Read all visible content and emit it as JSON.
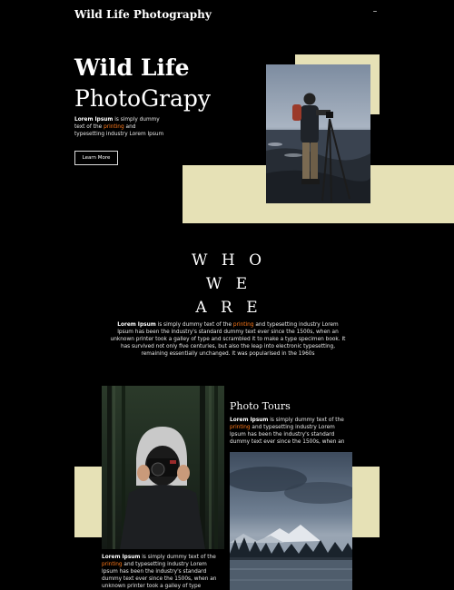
{
  "header": {
    "brand": "Wild Life Photography",
    "menu_icon": "menu-icon"
  },
  "hero": {
    "title_line1": "Wild Life",
    "title_line2": "PhotoGrapy",
    "desc_bold": "Lorem Ipsum",
    "desc_rest_1": " is simply dummy text of the ",
    "desc_highlight": "printing",
    "desc_rest_2": " and typesetting industry Lorem Ipsum",
    "button_label": "Learn More"
  },
  "about": {
    "heading_1": "W H O",
    "heading_2": "W E",
    "heading_3": "A R E",
    "desc_bold": "Lorem Ipsum",
    "desc_rest_1": " is simply dummy text of the ",
    "desc_highlight": "printing",
    "desc_rest_2": " and typesetting industry Lorem Ipsum has been the industry's standard dummy text ever since the 1500s, when an unknown printer took a galley of type and scrambled it to make a type specimen book. It has survived not only five centuries, but also the leap into electronic typesetting, remaining essentially unchanged. It was popularised in the 1960s"
  },
  "tours": {
    "title": "Photo Tours",
    "desc_bold": "Lorem Ipsum",
    "desc_rest_1": " is simply dummy text of the ",
    "desc_highlight": "printing",
    "desc_rest_2": " and typesetting industry Lorem Ipsum has been the industry's standard dummy text ever since the 1500s, when an"
  },
  "bottom": {
    "desc_bold": "Lorem Ipsum",
    "desc_rest_1": " is simply dummy text of the ",
    "desc_highlight": "printing",
    "desc_rest_2": " and typesetting industry Lorem Ipsum has been the industry's standard dummy text ever since the 1500s, when an unknown printer took a galley of type"
  },
  "colors": {
    "background": "#000000",
    "accent_beige": "#e6e1b6",
    "highlight": "#ff7a1a"
  }
}
